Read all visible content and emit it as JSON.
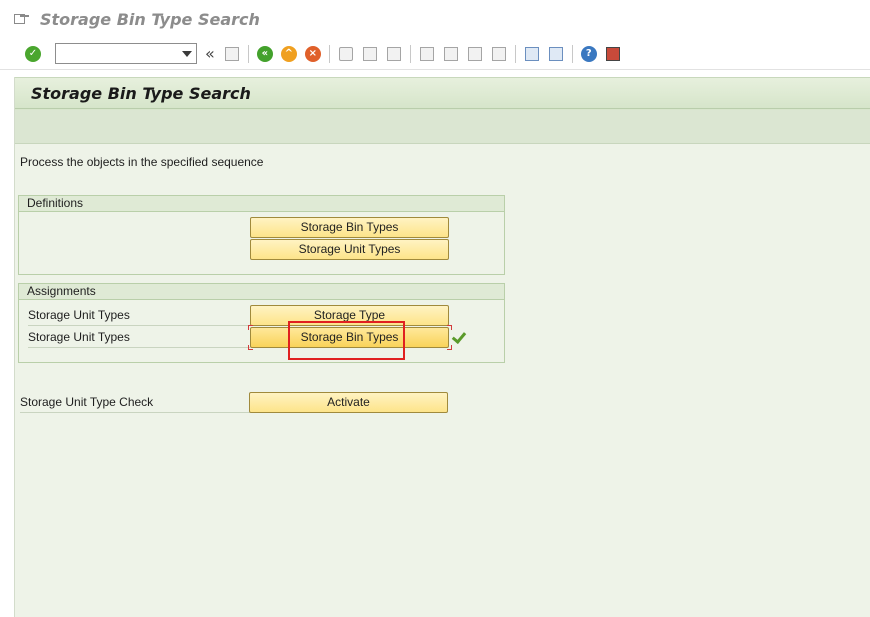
{
  "window": {
    "title": "Storage Bin Type Search"
  },
  "toolbar": {
    "command_field": {
      "value": "",
      "placeholder": ""
    },
    "icons": [
      "enter-icon",
      "save-icon",
      "back-icon",
      "exit-icon",
      "cancel-icon",
      "print-icon",
      "find-icon",
      "find-next-icon",
      "first-page-icon",
      "previous-page-icon",
      "next-page-icon",
      "last-page-icon",
      "create-session-icon",
      "shortcut-icon",
      "help-icon",
      "customize-layout-icon"
    ],
    "chevron": "«"
  },
  "header": {
    "title": "Storage Bin Type Search"
  },
  "instruction": "Process the objects in the specified sequence",
  "groups": {
    "definitions": {
      "title": "Definitions",
      "buttons": [
        "Storage Bin Types",
        "Storage Unit Types"
      ]
    },
    "assignments": {
      "title": "Assignments",
      "rows": [
        {
          "label": "Storage Unit Types",
          "button": "Storage Type"
        },
        {
          "label": "Storage Unit Types",
          "button": "Storage Bin Types"
        }
      ]
    }
  },
  "check": {
    "label": "Storage Unit Type Check",
    "button": "Activate"
  },
  "colors": {
    "accent_green": "#5a9a2a",
    "button_yellow": "#fde48a",
    "highlight_red": "#e02020"
  }
}
